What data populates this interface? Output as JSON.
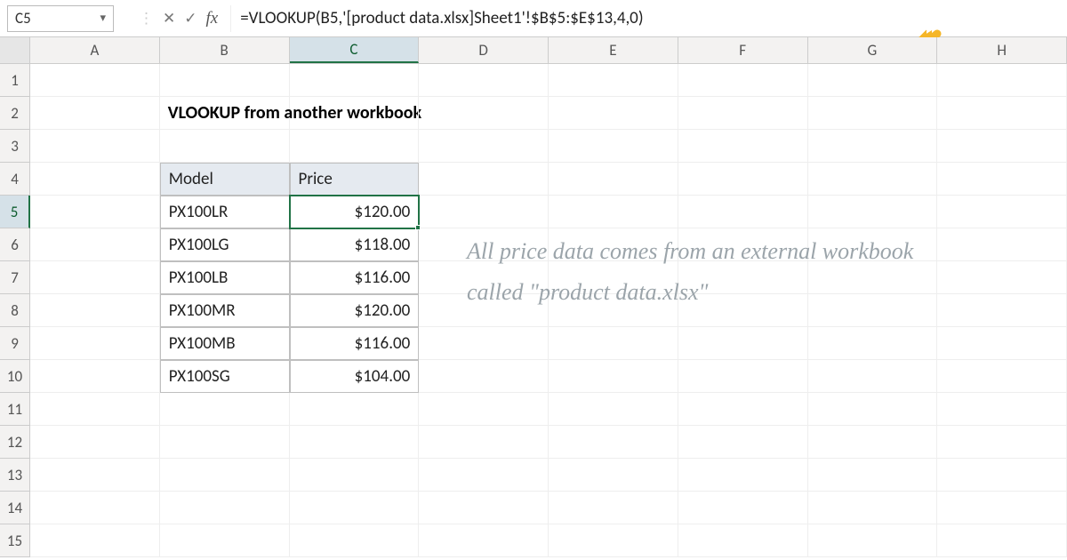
{
  "name_box": "C5",
  "formula": "=VLOOKUP(B5,'[product data.xlsx]Sheet1'!$B$5:$E$13,4,0)",
  "columns": [
    "A",
    "B",
    "C",
    "D",
    "E",
    "F",
    "G",
    "H"
  ],
  "selected_col": "C",
  "selected_row": "5",
  "title": "VLOOKUP from another workbook",
  "table": {
    "headers": {
      "model": "Model",
      "price": "Price"
    },
    "rows": [
      {
        "model": "PX100LR",
        "price": "$120.00"
      },
      {
        "model": "PX100LG",
        "price": "$118.00"
      },
      {
        "model": "PX100LB",
        "price": "$116.00"
      },
      {
        "model": "PX100MR",
        "price": "$120.00"
      },
      {
        "model": "PX100MB",
        "price": "$116.00"
      },
      {
        "model": "PX100SG",
        "price": "$104.00"
      }
    ]
  },
  "annotation": "All price data comes from an external workbook called \"product data.xlsx\""
}
